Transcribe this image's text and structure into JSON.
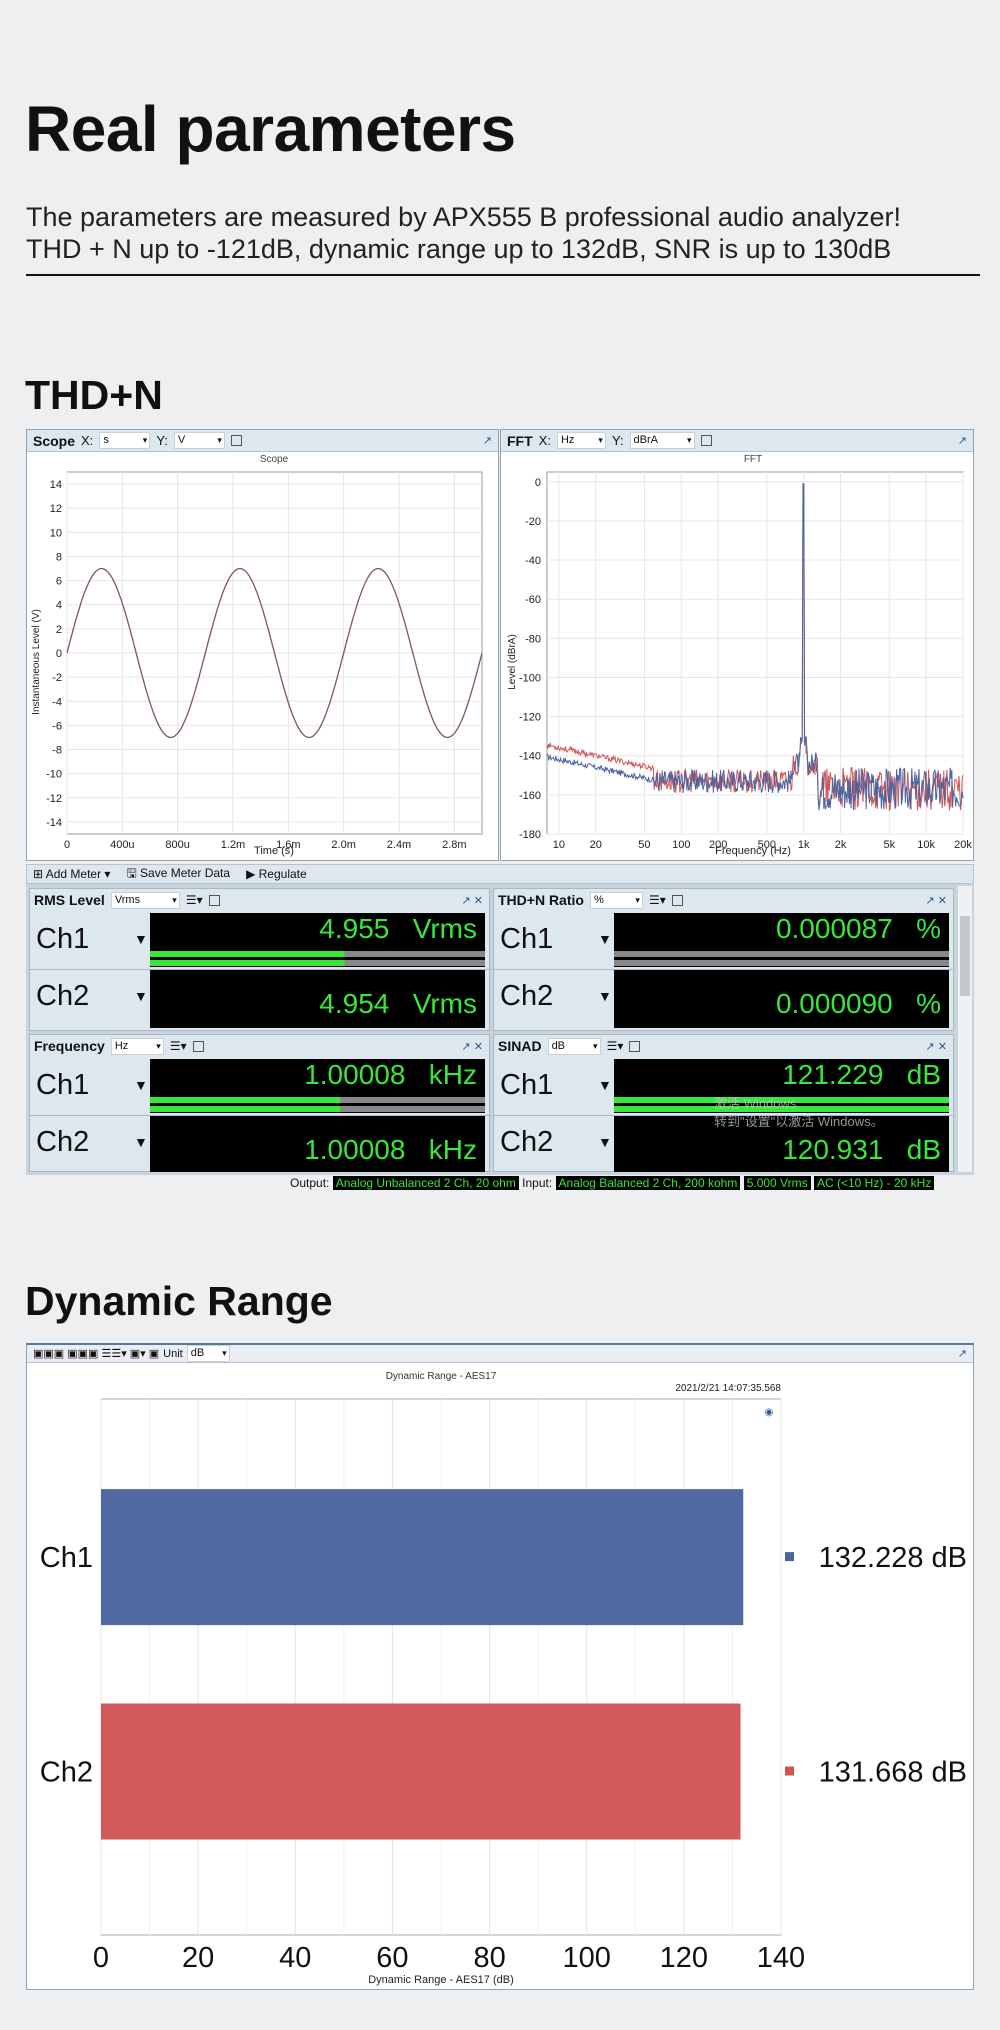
{
  "page": {
    "title": "Real parameters",
    "intro_line1": "The parameters are measured by APX555 B professional audio analyzer!",
    "intro_line2": "THD + N up to -121dB, dynamic range up to 132dB, SNR is up to 130dB"
  },
  "sections": {
    "thdn_title": "THD+N",
    "dr_title": "Dynamic Range"
  },
  "scope": {
    "panel_label": "Scope",
    "x_label": "X:",
    "x_unit": "s",
    "y_label": "Y:",
    "y_unit": "V",
    "chart_title": "Scope",
    "xlabel": "Time (s)",
    "ylabel": "Instantaneous Level (V)"
  },
  "fft": {
    "panel_label": "FFT",
    "x_label": "X:",
    "x_unit": "Hz",
    "y_label": "Y:",
    "y_unit": "dBrA",
    "chart_title": "FFT",
    "xlabel": "Frequency (Hz)",
    "ylabel": "Level (dBrA)"
  },
  "meter_toolbar": {
    "add_meter": "Add Meter",
    "save_meter": "Save Meter Data",
    "regulate": "Regulate"
  },
  "meters": {
    "rms": {
      "label": "RMS Level",
      "unit_select": "Vrms",
      "ch1": {
        "name": "Ch1",
        "value": "4.955",
        "unit": "Vrms"
      },
      "ch2": {
        "name": "Ch2",
        "value": "4.954",
        "unit": "Vrms"
      }
    },
    "thdn": {
      "label": "THD+N Ratio",
      "unit_select": "%",
      "ch1": {
        "name": "Ch1",
        "value": "0.000087",
        "unit": "%"
      },
      "ch2": {
        "name": "Ch2",
        "value": "0.000090",
        "unit": "%"
      }
    },
    "freq": {
      "label": "Frequency",
      "unit_select": "Hz",
      "ch1": {
        "name": "Ch1",
        "value": "1.00008",
        "unit": "kHz"
      },
      "ch2": {
        "name": "Ch2",
        "value": "1.00008",
        "unit": "kHz"
      }
    },
    "sinad": {
      "label": "SINAD",
      "unit_select": "dB",
      "ch1": {
        "name": "Ch1",
        "value": "121.229",
        "unit": "dB"
      },
      "ch2": {
        "name": "Ch2",
        "value": "120.931",
        "unit": "dB"
      }
    }
  },
  "watermark": {
    "line1": "激活 Windows",
    "line2": "转到\"设置\"以激活 Windows。"
  },
  "status": {
    "output_label": "Output:",
    "output_value": "Analog Unbalanced 2 Ch, 20 ohm",
    "input_label": "Input:",
    "input_value": "Analog Balanced 2 Ch, 200 kohm",
    "level": "5.000 Vrms",
    "filter": "AC (<10 Hz) - 20 kHz"
  },
  "dr_toolbar": {
    "unit_label": "Unit",
    "unit_value": "dB"
  },
  "colors": {
    "ch1": "#4a64a0",
    "ch2": "#d25555",
    "meter_green": "#39e639",
    "meter_bg": "#000000"
  },
  "chart_data": [
    {
      "type": "line",
      "title": "Scope",
      "xlabel": "Time (s)",
      "ylabel": "Instantaneous Level (V)",
      "xlim": [
        0,
        0.003
      ],
      "ylim": [
        -15,
        15
      ],
      "x_ticks": [
        "0",
        "400u",
        "800u",
        "1.2m",
        "1.6m",
        "2.0m",
        "2.4m",
        "2.8m"
      ],
      "y_ticks": [
        "14",
        "12",
        "10",
        "8",
        "6",
        "4",
        "2",
        "0",
        "-2",
        "-4",
        "-6",
        "-8",
        "-10",
        "-12",
        "-14"
      ],
      "series": [
        {
          "name": "Ch1",
          "amplitude": 7.0,
          "frequency_hz": 1000,
          "phase_deg": 0
        },
        {
          "name": "Ch2",
          "amplitude": 7.0,
          "frequency_hz": 1000,
          "phase_deg": 0
        }
      ]
    },
    {
      "type": "line",
      "title": "FFT",
      "xlabel": "Frequency (Hz)",
      "ylabel": "Level (dBrA)",
      "xscale": "log",
      "xlim": [
        8,
        20000
      ],
      "ylim": [
        -180,
        5
      ],
      "x_ticks": [
        "10",
        "20",
        "50",
        "100",
        "200",
        "500",
        "1k",
        "2k",
        "5k",
        "10k",
        "20k"
      ],
      "y_ticks": [
        "0",
        "-20",
        "-40",
        "-60",
        "-80",
        "-100",
        "-120",
        "-140",
        "-160",
        "-180"
      ],
      "peak": {
        "frequency_hz": 1000,
        "level_dbra": -1
      }
    },
    {
      "type": "bar",
      "orientation": "horizontal",
      "title": "Dynamic Range - AES17",
      "timestamp": "2021/2/21 14:07:35.568",
      "xlabel": "Dynamic Range - AES17 (dB)",
      "xlim": [
        0,
        140
      ],
      "x_ticks": [
        "0",
        "20",
        "40",
        "60",
        "80",
        "100",
        "120",
        "140"
      ],
      "categories": [
        "Ch1",
        "Ch2"
      ],
      "values": [
        132.228,
        131.668
      ],
      "value_labels": [
        "132.228 dB",
        "131.668 dB"
      ]
    }
  ]
}
